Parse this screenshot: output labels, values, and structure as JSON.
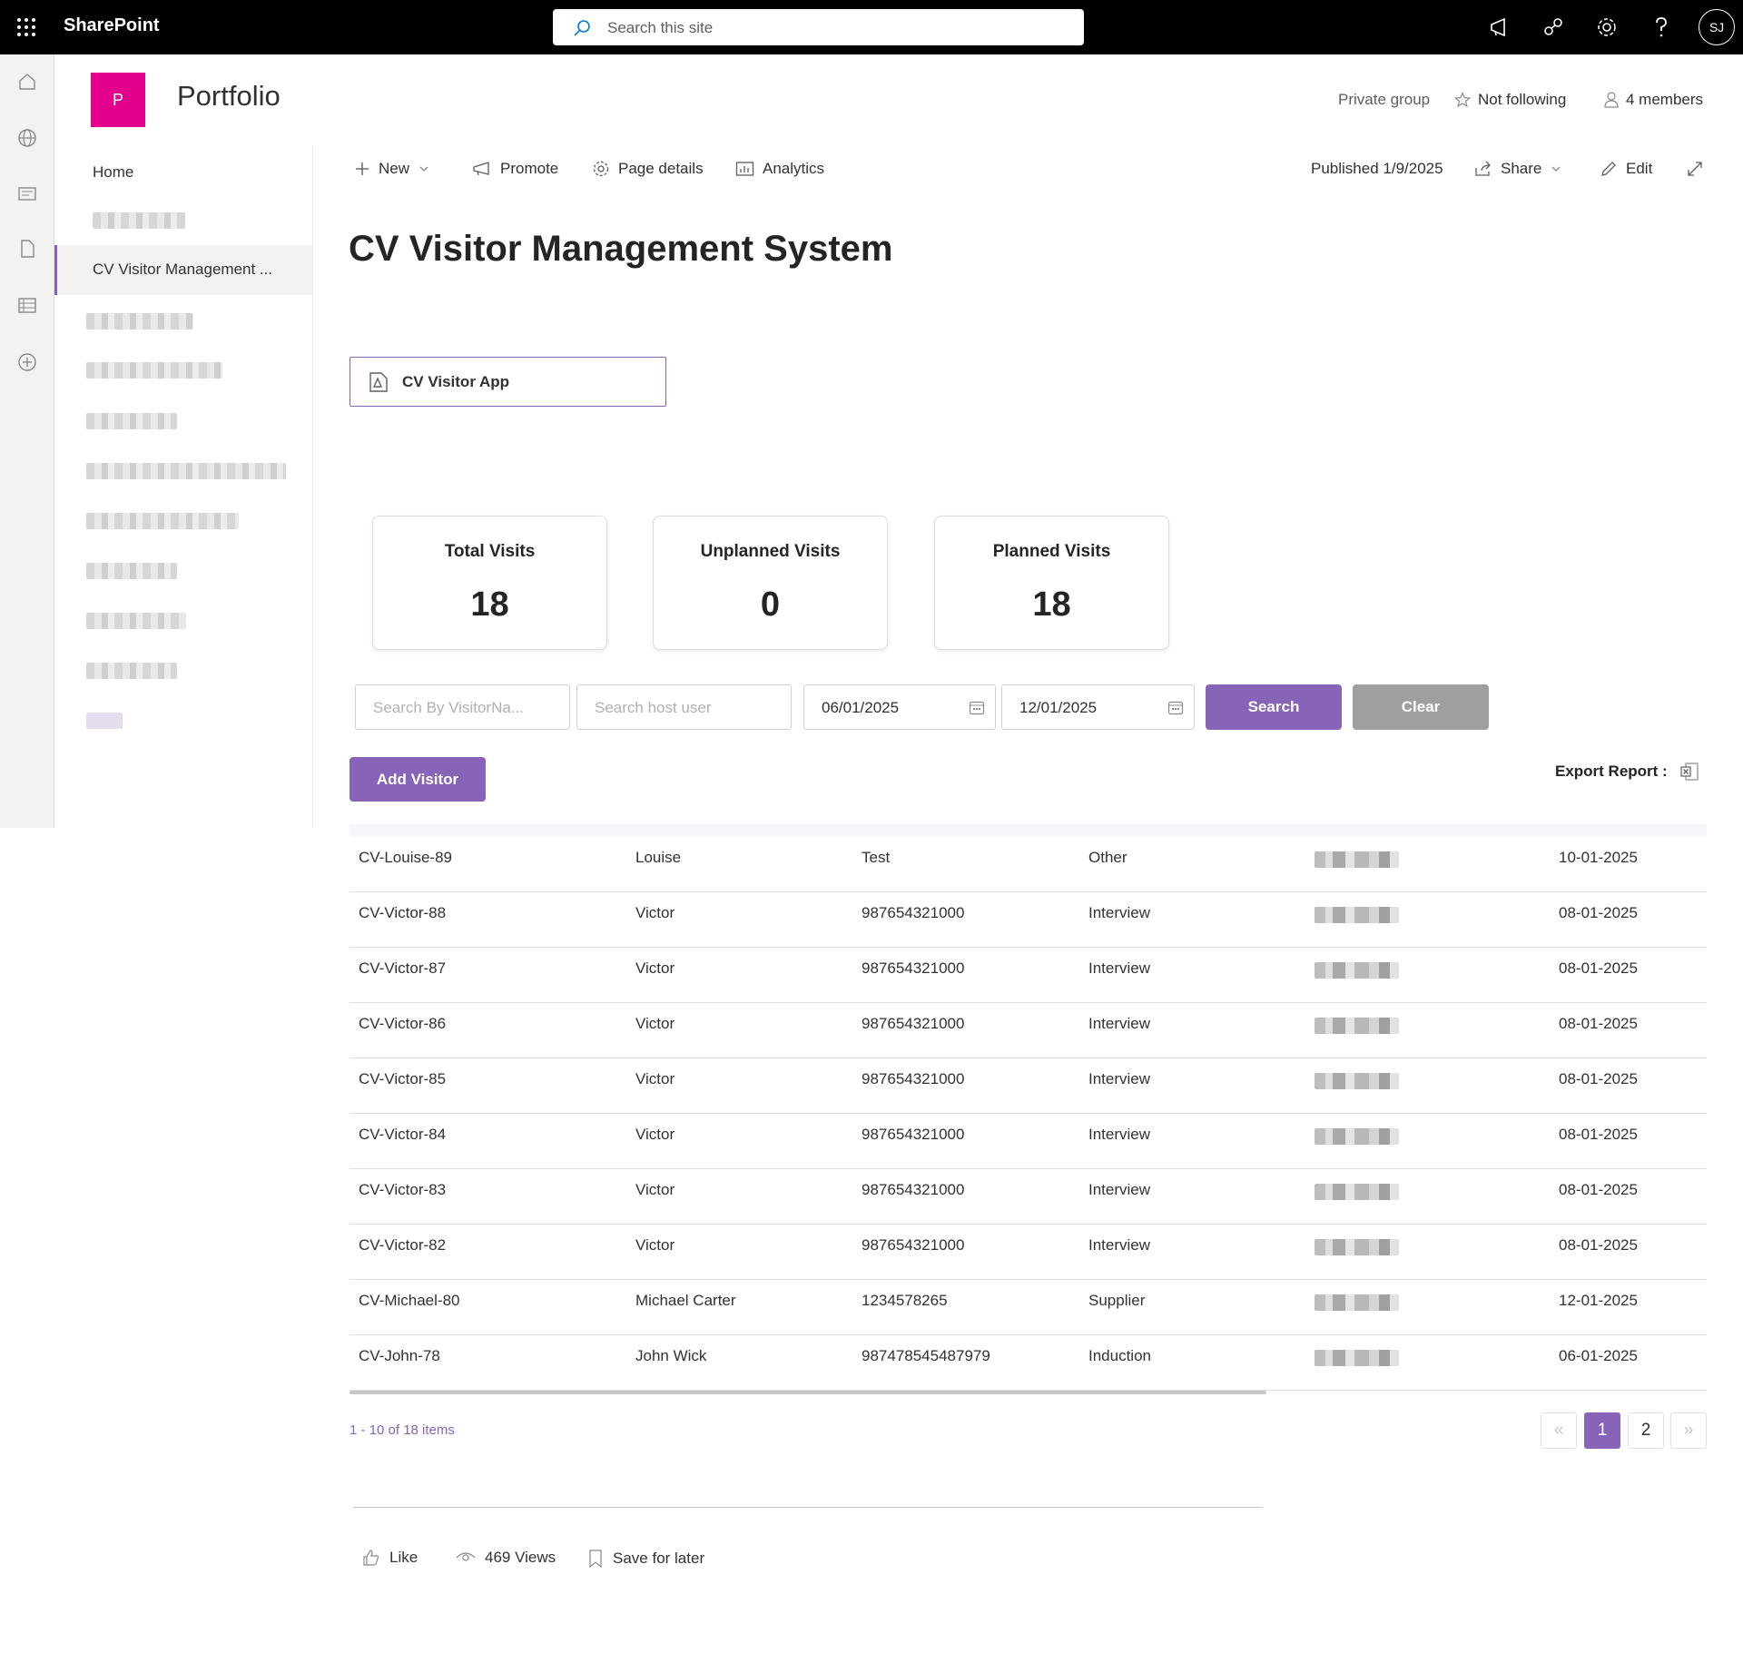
{
  "topbar": {
    "app_name": "SharePoint",
    "search_placeholder": "Search this site",
    "avatar_initials": "SJ"
  },
  "site": {
    "logo_letter": "P",
    "name": "Portfolio",
    "privacy": "Private group",
    "follow": "Not following",
    "members": "4 members"
  },
  "leftnav": {
    "home": "Home",
    "active_item": "CV Visitor Management ..."
  },
  "commandbar": {
    "new": "New",
    "promote": "Promote",
    "page_details": "Page details",
    "analytics": "Analytics",
    "published": "Published 1/9/2025",
    "share": "Share",
    "edit": "Edit"
  },
  "page": {
    "title": "CV Visitor Management System",
    "app_button": "CV Visitor App"
  },
  "stats": [
    {
      "label": "Total Visits",
      "value": "18"
    },
    {
      "label": "Unplanned Visits",
      "value": "0"
    },
    {
      "label": "Planned Visits",
      "value": "18"
    }
  ],
  "filters": {
    "visitor_placeholder": "Search By VisitorNa...",
    "host_placeholder": "Search host user",
    "from_date": "06/01/2025",
    "to_date": "12/01/2025",
    "search_label": "Search",
    "clear_label": "Clear"
  },
  "actions": {
    "add_visitor": "Add Visitor",
    "export_report": "Export Report :"
  },
  "table": {
    "rows": [
      {
        "id": "CV-Louise-89",
        "name": "Louise",
        "phone": "Test",
        "purpose": "Other",
        "date": "10-01-2025"
      },
      {
        "id": "CV-Victor-88",
        "name": "Victor",
        "phone": "987654321000",
        "purpose": "Interview",
        "date": "08-01-2025"
      },
      {
        "id": "CV-Victor-87",
        "name": "Victor",
        "phone": "987654321000",
        "purpose": "Interview",
        "date": "08-01-2025"
      },
      {
        "id": "CV-Victor-86",
        "name": "Victor",
        "phone": "987654321000",
        "purpose": "Interview",
        "date": "08-01-2025"
      },
      {
        "id": "CV-Victor-85",
        "name": "Victor",
        "phone": "987654321000",
        "purpose": "Interview",
        "date": "08-01-2025"
      },
      {
        "id": "CV-Victor-84",
        "name": "Victor",
        "phone": "987654321000",
        "purpose": "Interview",
        "date": "08-01-2025"
      },
      {
        "id": "CV-Victor-83",
        "name": "Victor",
        "phone": "987654321000",
        "purpose": "Interview",
        "date": "08-01-2025"
      },
      {
        "id": "CV-Victor-82",
        "name": "Victor",
        "phone": "987654321000",
        "purpose": "Interview",
        "date": "08-01-2025"
      },
      {
        "id": "CV-Michael-80",
        "name": "Michael Carter",
        "phone": "1234578265",
        "purpose": "Supplier",
        "date": "12-01-2025"
      },
      {
        "id": "CV-John-78",
        "name": "John Wick",
        "phone": "987478545487979",
        "purpose": "Induction",
        "date": "06-01-2025"
      }
    ]
  },
  "pagination": {
    "summary": "1 - 10 of 18 items",
    "first": "«",
    "page1": "1",
    "page2": "2",
    "last": "»"
  },
  "footer": {
    "like": "Like",
    "views": "469 Views",
    "save": "Save for later"
  },
  "colors": {
    "accent": "#8764b8",
    "site_logo": "#e3008c",
    "topbar": "#000000",
    "clear_button": "#a19f9d"
  },
  "icons": [
    "waffle-icon",
    "search-icon",
    "megaphone-icon",
    "share-network-icon",
    "gear-icon",
    "help-icon",
    "home-icon",
    "globe-icon",
    "news-icon",
    "document-icon",
    "list-icon",
    "add-circle-icon",
    "star-icon",
    "person-icon",
    "plus-icon",
    "chevron-down-icon",
    "promote-icon",
    "settings-icon",
    "analytics-icon",
    "share-icon",
    "pencil-icon",
    "expand-icon",
    "powerapps-icon",
    "calendar-icon",
    "excel-icon",
    "like-icon",
    "eye-icon",
    "bookmark-icon"
  ]
}
